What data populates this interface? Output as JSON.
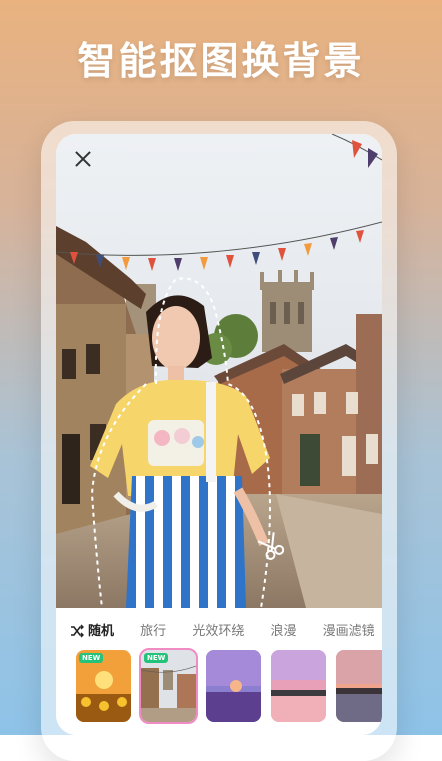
{
  "headline": "智能抠图换背景",
  "editor": {
    "close_icon": "close-icon",
    "scissor_icon": "scissors-icon"
  },
  "tabs": [
    {
      "label": "随机",
      "icon": "shuffle-icon",
      "active": true
    },
    {
      "label": "旅行",
      "active": false
    },
    {
      "label": "光效环绕",
      "active": false
    },
    {
      "label": "浪漫",
      "active": false
    },
    {
      "label": "漫画滤镜",
      "active": false
    }
  ],
  "thumbnails": [
    {
      "badge": "NEW",
      "scene": "sunset-sunflowers",
      "selected": false
    },
    {
      "badge": "NEW",
      "scene": "old-town-street",
      "selected": true
    },
    {
      "badge": "",
      "scene": "lavender-field",
      "selected": false
    },
    {
      "badge": "",
      "scene": "pink-sky-lake",
      "selected": false
    },
    {
      "badge": "",
      "scene": "sunset-sea",
      "selected": false
    }
  ],
  "colors": {
    "accent": "#f08bc4",
    "new_badge": "#25c27a"
  }
}
